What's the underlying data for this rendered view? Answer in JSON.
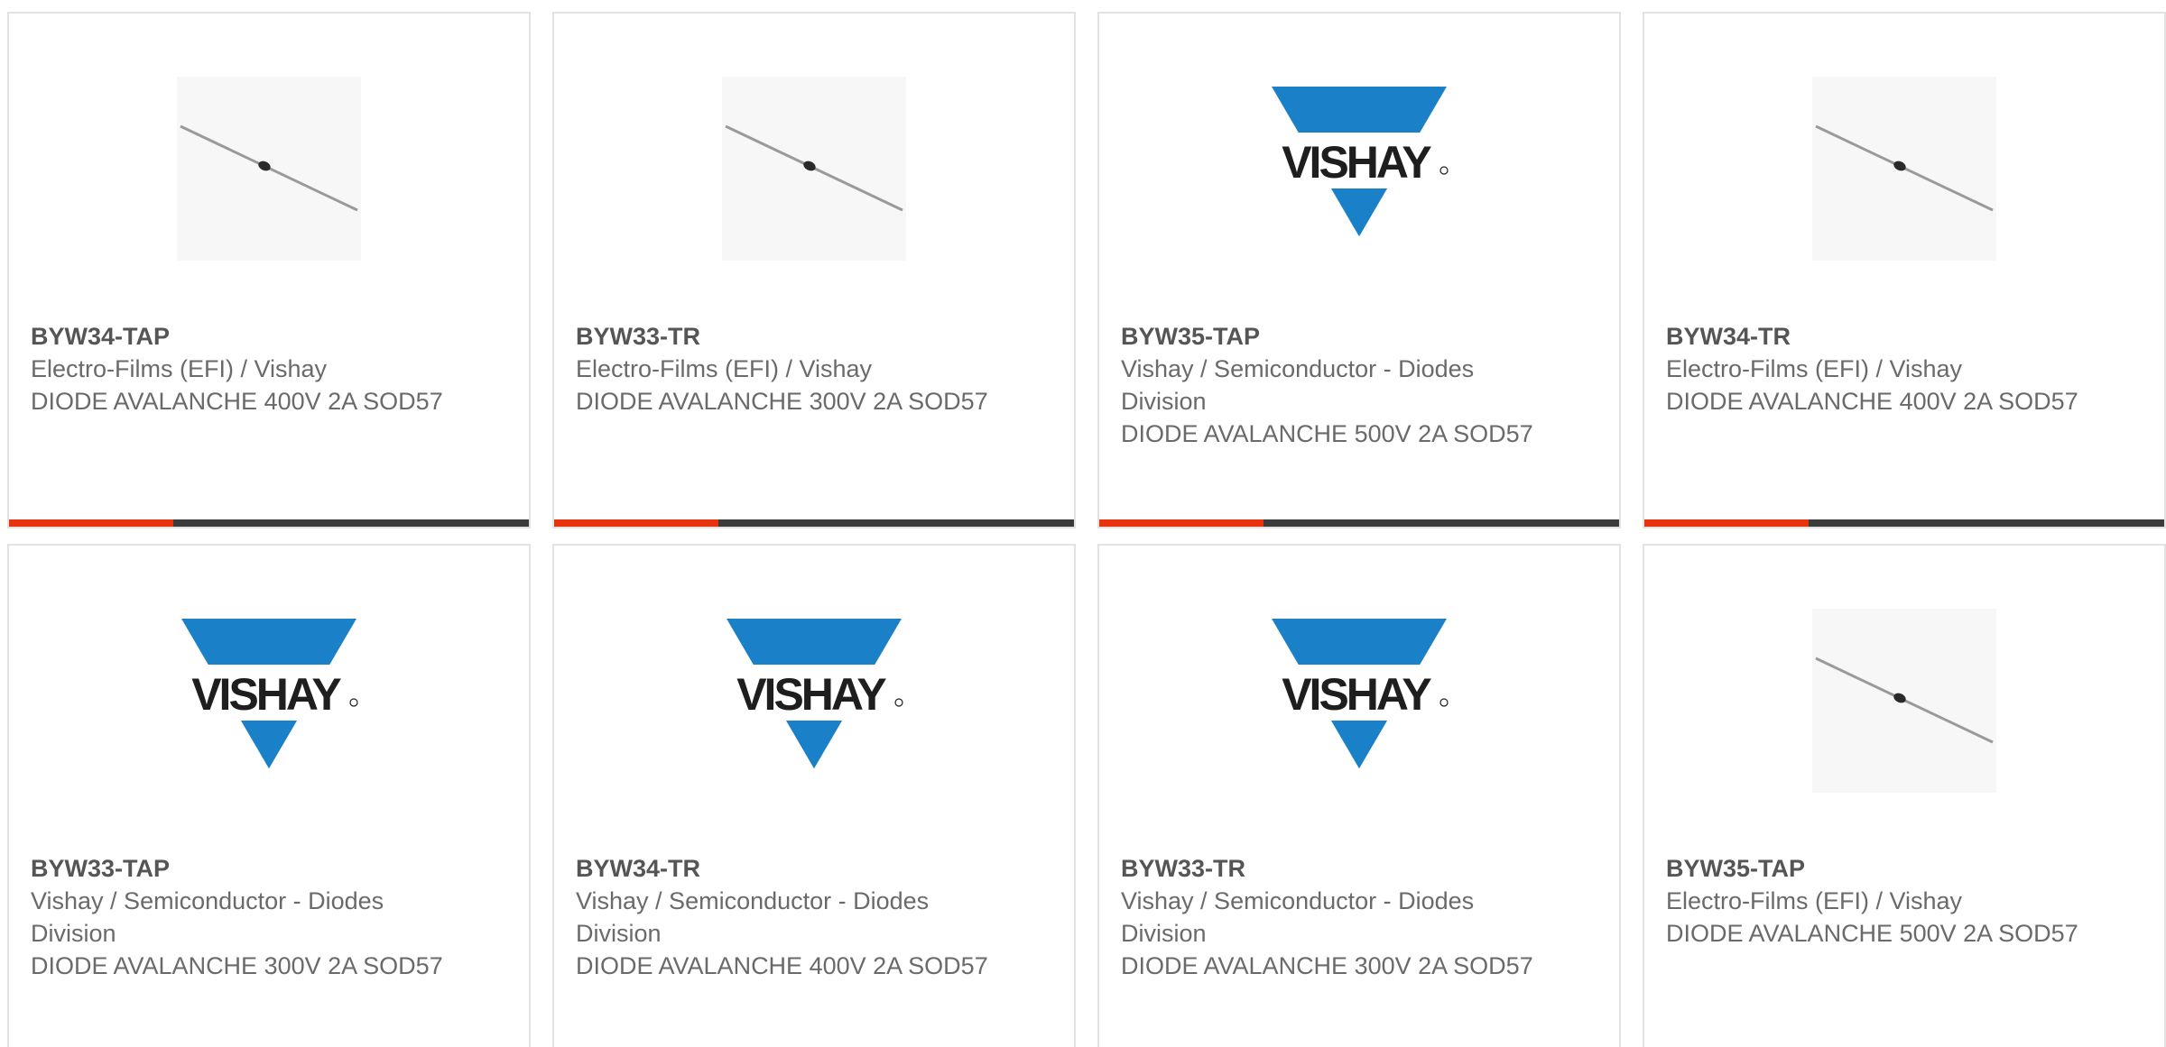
{
  "colors": {
    "bar_dark": "#3b3b3b",
    "bar_accent": "#e8340e",
    "vishay_blue": "#1a80c7"
  },
  "products": [
    {
      "part": "BYW34-TAP",
      "manufacturer": "Electro-Films (EFI) / Vishay",
      "description": "DIODE AVALANCHE 400V 2A SOD57",
      "image": "diode-icon"
    },
    {
      "part": "BYW33-TR",
      "manufacturer": "Electro-Films (EFI) / Vishay",
      "description": "DIODE AVALANCHE 300V 2A SOD57",
      "image": "diode-icon"
    },
    {
      "part": "BYW35-TAP",
      "manufacturer": "Vishay / Semiconductor - Diodes Division",
      "description": "DIODE AVALANCHE 500V 2A SOD57",
      "image": "vishay-logo",
      "logo_text": "VISHAY"
    },
    {
      "part": "BYW34-TR",
      "manufacturer": "Electro-Films (EFI) / Vishay",
      "description": "DIODE AVALANCHE 400V 2A SOD57",
      "image": "diode-icon"
    },
    {
      "part": "BYW33-TAP",
      "manufacturer": "Vishay / Semiconductor - Diodes Division",
      "description": "DIODE AVALANCHE 300V 2A SOD57",
      "image": "vishay-logo",
      "logo_text": "VISHAY"
    },
    {
      "part": "BYW34-TR",
      "manufacturer": "Vishay / Semiconductor - Diodes Division",
      "description": "DIODE AVALANCHE 400V 2A SOD57",
      "image": "vishay-logo",
      "logo_text": "VISHAY"
    },
    {
      "part": "BYW33-TR",
      "manufacturer": "Vishay / Semiconductor - Diodes Division",
      "description": "DIODE AVALANCHE 300V 2A SOD57",
      "image": "vishay-logo",
      "logo_text": "VISHAY"
    },
    {
      "part": "BYW35-TAP",
      "manufacturer": "Electro-Films (EFI) / Vishay",
      "description": "DIODE AVALANCHE 500V 2A SOD57",
      "image": "diode-icon"
    }
  ]
}
